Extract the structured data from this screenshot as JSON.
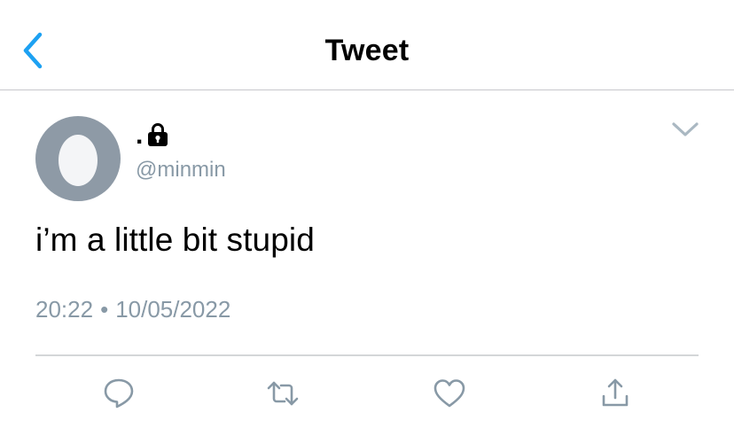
{
  "header": {
    "back_icon": "chevron-left-icon",
    "title": "Tweet",
    "accent_color": "#1da1f2"
  },
  "tweet": {
    "display_name": ".",
    "protected_icon": "lock-icon",
    "username": "@minmin",
    "text": "i’m a little bit stupid",
    "time": "20:22",
    "separator": "•",
    "date": "10/05/2022",
    "menu_icon": "chevron-down-icon"
  },
  "actions": [
    {
      "name": "reply",
      "icon": "comment-icon"
    },
    {
      "name": "retweet",
      "icon": "retweet-icon"
    },
    {
      "name": "like",
      "icon": "heart-icon"
    },
    {
      "name": "share",
      "icon": "share-icon"
    }
  ],
  "colors": {
    "text": "#000000",
    "secondary_text": "#8899a6",
    "avatar_bg": "#8e9aa6",
    "icon_gray": "#8899a6"
  }
}
